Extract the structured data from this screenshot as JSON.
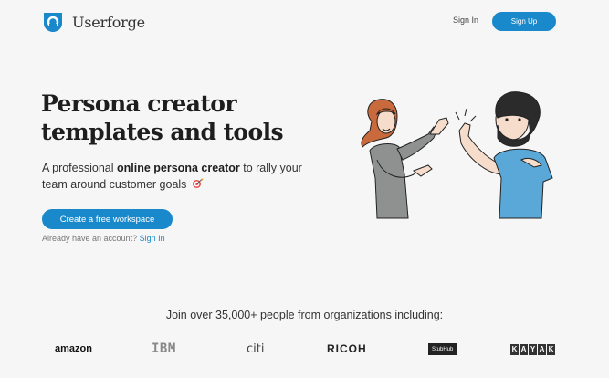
{
  "header": {
    "brand": "Userforge",
    "signin": "Sign In",
    "signup": "Sign Up"
  },
  "hero": {
    "title_line1": "Persona creator",
    "title_line2": "templates and tools",
    "sub_prefix": "A professional ",
    "sub_bold": "online persona creator",
    "sub_suffix": " to rally your team around customer goals",
    "cta": "Create a free workspace",
    "account_prompt": "Already have an account? ",
    "account_signin": "Sign In"
  },
  "social_proof": {
    "join": "Join over 35,000+ people from organizations including:",
    "brands": {
      "amazon": "amazon",
      "ibm": "IBM",
      "citi": "citi",
      "ricoh": "RICOH",
      "stubhub": "StubHub",
      "kayak": [
        "K",
        "A",
        "Y",
        "A",
        "K"
      ]
    }
  },
  "colors": {
    "accent": "#1a89cb",
    "background": "#f6f6f6"
  },
  "icons": {
    "logo": "userforge-logo-icon",
    "target": "target-icon"
  }
}
